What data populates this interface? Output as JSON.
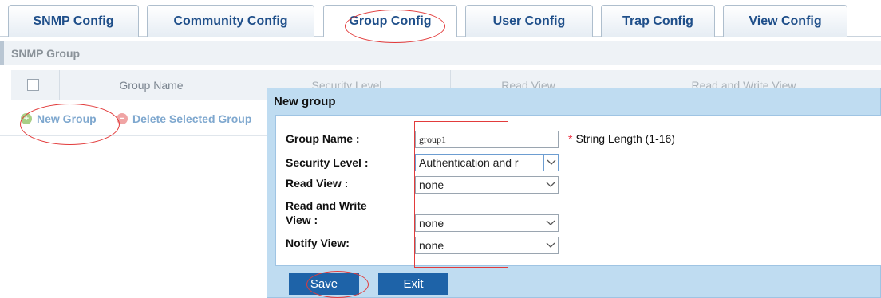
{
  "tabs": [
    {
      "label": "SNMP Config"
    },
    {
      "label": "Community Config"
    },
    {
      "label": "Group Config"
    },
    {
      "label": "User Config"
    },
    {
      "label": "Trap Config"
    },
    {
      "label": "View Config"
    }
  ],
  "active_tab": "Group Config",
  "section": {
    "title": "SNMP Group"
  },
  "table": {
    "columns": [
      "Group Name",
      "Security Level",
      "Read View",
      "Read and Write View"
    ]
  },
  "actions": {
    "new_group": "New Group",
    "delete_selected": "Delete Selected Group"
  },
  "dialog": {
    "title": "New group",
    "fields": {
      "group_name": {
        "label": "Group Name :",
        "value": "group1",
        "hint": "String Length (1-16)",
        "required_mark": "*"
      },
      "security_level": {
        "label": "Security Level :",
        "value": "Authentication and r"
      },
      "read_view": {
        "label": "Read View :",
        "value": "none"
      },
      "read_write_view": {
        "label_line1": "Read and Write",
        "label_line2": "View :",
        "value": "none"
      },
      "notify_view": {
        "label": "Notify View:",
        "value": "none"
      }
    },
    "buttons": {
      "save": "Save",
      "exit": "Exit"
    }
  },
  "colors": {
    "tab_text": "#1f4f8a",
    "dialog_bg": "#bfdcf1",
    "button_bg": "#1e63a8",
    "annotation": "#e23b3b"
  }
}
